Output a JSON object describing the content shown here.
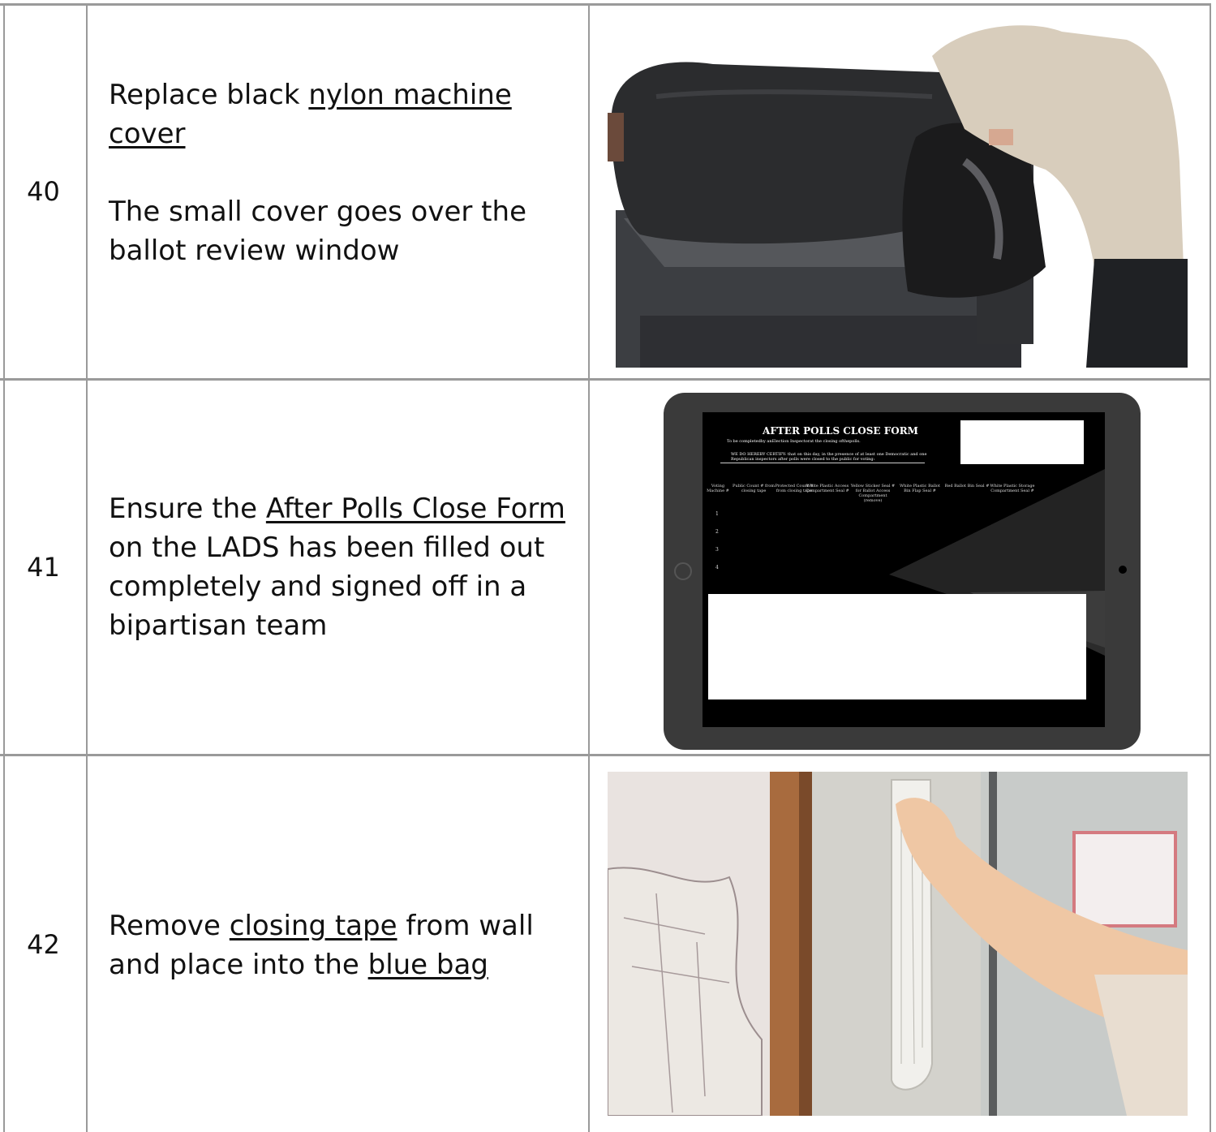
{
  "rows": [
    {
      "number": "40",
      "line1_pre": "Replace black ",
      "line1_link": "nylon machine cover",
      "line2": "The small cover goes over the ballot review window",
      "image": "person-covering-voting-machine-photo"
    },
    {
      "number": "41",
      "pre": "Ensure the ",
      "link": "After Polls Close Form",
      "post": " on the LADS has been filled out completely and signed off in a bipartisan team",
      "image": "tablet-form-screenshot",
      "form": {
        "title": "AFTER POLLS CLOSE FORM",
        "subtitle": "To be completedby anElection Inspectorat the closing ofthepolls.",
        "certify": "WE DO HEREBY CERTIFY: that on this day, in the presence of at least one Democratic and one Republican inspectors after polls were closed to the public for voting:",
        "columns": [
          "Voting Machine #",
          "Public Count # from closing tape",
          "Protected Count # from closing tape",
          "White Plastic Access Compartment Seal #",
          "Yellow Sticker Seal # for Ballot Access Compartment (remove)",
          "White Plastic Ballot Bin Flap Seal #",
          "Red Ballot Bin Seal #",
          "White Plastic Storage Compartment Seal #"
        ],
        "row_numbers": [
          "1",
          "2",
          "3",
          "4"
        ]
      }
    },
    {
      "number": "42",
      "pre": "Remove ",
      "link1": "closing tape",
      "mid": " from wall and place into the ",
      "link2": "blue bag",
      "image": "hand-removing-closing-tape-photo"
    }
  ]
}
